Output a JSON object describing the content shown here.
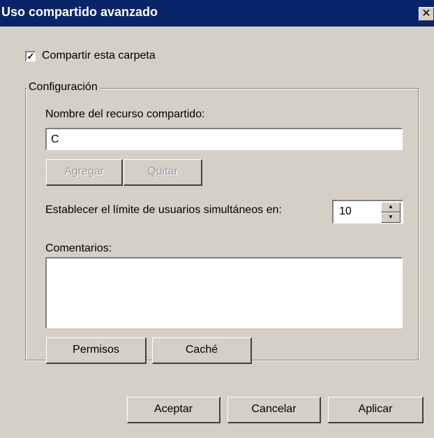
{
  "window": {
    "title": "Uso compartido avanzado",
    "close_symbol": "✕"
  },
  "share": {
    "checkbox_label": "Compartir esta carpeta",
    "checked": true,
    "check_symbol": "✓"
  },
  "group": {
    "legend": "Configuración",
    "share_name_label": "Nombre del recurso compartido:",
    "share_name_value": "C",
    "add_label": "Agregar",
    "remove_label": "Quitar",
    "limit_label": "Establecer el límite de usuarios simultáneos en:",
    "limit_value": "10",
    "comments_label": "Comentarios:",
    "comments_value": "",
    "permissions_label": "Permisos",
    "cache_label": "Caché"
  },
  "footer": {
    "ok_label": "Aceptar",
    "cancel_label": "Cancelar",
    "apply_label": "Aplicar"
  }
}
